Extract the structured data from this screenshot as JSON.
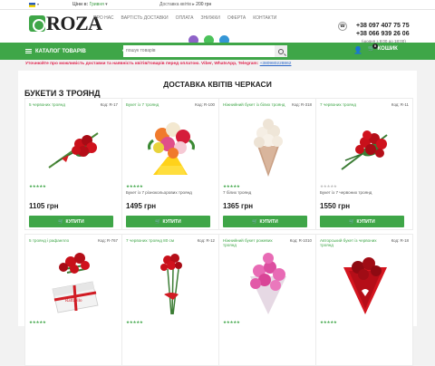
{
  "topbar": {
    "currency_label": "Ціни в:",
    "currency_value": "Гривня",
    "delivery_label": "Доставка квітів",
    "delivery_price": "200 грн"
  },
  "header": {
    "logo_text": "ROZA",
    "nav": [
      "ПРО НАС",
      "ВАРТІСТЬ ДОСТАВКИ",
      "ОПЛАТА",
      "ЗНИЖКИ",
      "ОФЕРТА",
      "КОНТАКТИ"
    ],
    "phone1": "+38 097 407 75 75",
    "phone2": "+38 066 939 26 06",
    "hours": "(щодня з 9:00 до 18:00)"
  },
  "greenbar": {
    "catalog_label": "КАТАЛОГ ТОВАРІВ",
    "search_placeholder": "пошук товарів",
    "cart_label": "КОШИК",
    "cart_count": "0"
  },
  "warning": {
    "text": "Уточнюйте про можливість доставки та наявність квітів/товарів перед оплатою. Viber, WhatsApp, Telegram:",
    "phone": "+380980228862"
  },
  "page": {
    "title": "ДОСТАВКА КВІТІВ ЧЕРКАСИ",
    "section": "БУКЕТИ З ТРОЯНД"
  },
  "products": [
    {
      "name": "5 червоних троянд",
      "code": "Код: R-17",
      "stars": "★★★★★",
      "desc": "",
      "price": "1105 грн",
      "buy": "КУПИТИ"
    },
    {
      "name": "Букет із 7 троянд",
      "code": "Код: R-100",
      "stars": "★★★★★",
      "desc": "Букет із 7 різнокольорових троянд",
      "price": "1495 грн",
      "buy": "КУПИТИ"
    },
    {
      "name": "Ніжнийний букет із білих троянд",
      "code": "Код: R-318",
      "stars": "★★★★★",
      "desc": "7 білих троянд",
      "price": "1365 грн",
      "buy": "КУПИТИ"
    },
    {
      "name": "7 червоних троянд",
      "code": "Код: R-11",
      "stars": "★★★★★",
      "desc": "Букет із 7 червоних троянд",
      "price": "1550 грн",
      "buy": "КУПИТИ"
    },
    {
      "name": "5 троянд і рафаелло",
      "code": "Код: R-767",
      "stars": "★★★★★"
    },
    {
      "name": "7 червоних троянд 80 см",
      "code": "Код: R-12",
      "stars": "★★★★★"
    },
    {
      "name": "Ніжнийний букет рожевих троянд",
      "code": "Код: R-1010",
      "stars": "★★★★★"
    },
    {
      "name": "Авторський букет із червоних троянд",
      "code": "Код: R-18",
      "stars": "★★★★★"
    }
  ]
}
